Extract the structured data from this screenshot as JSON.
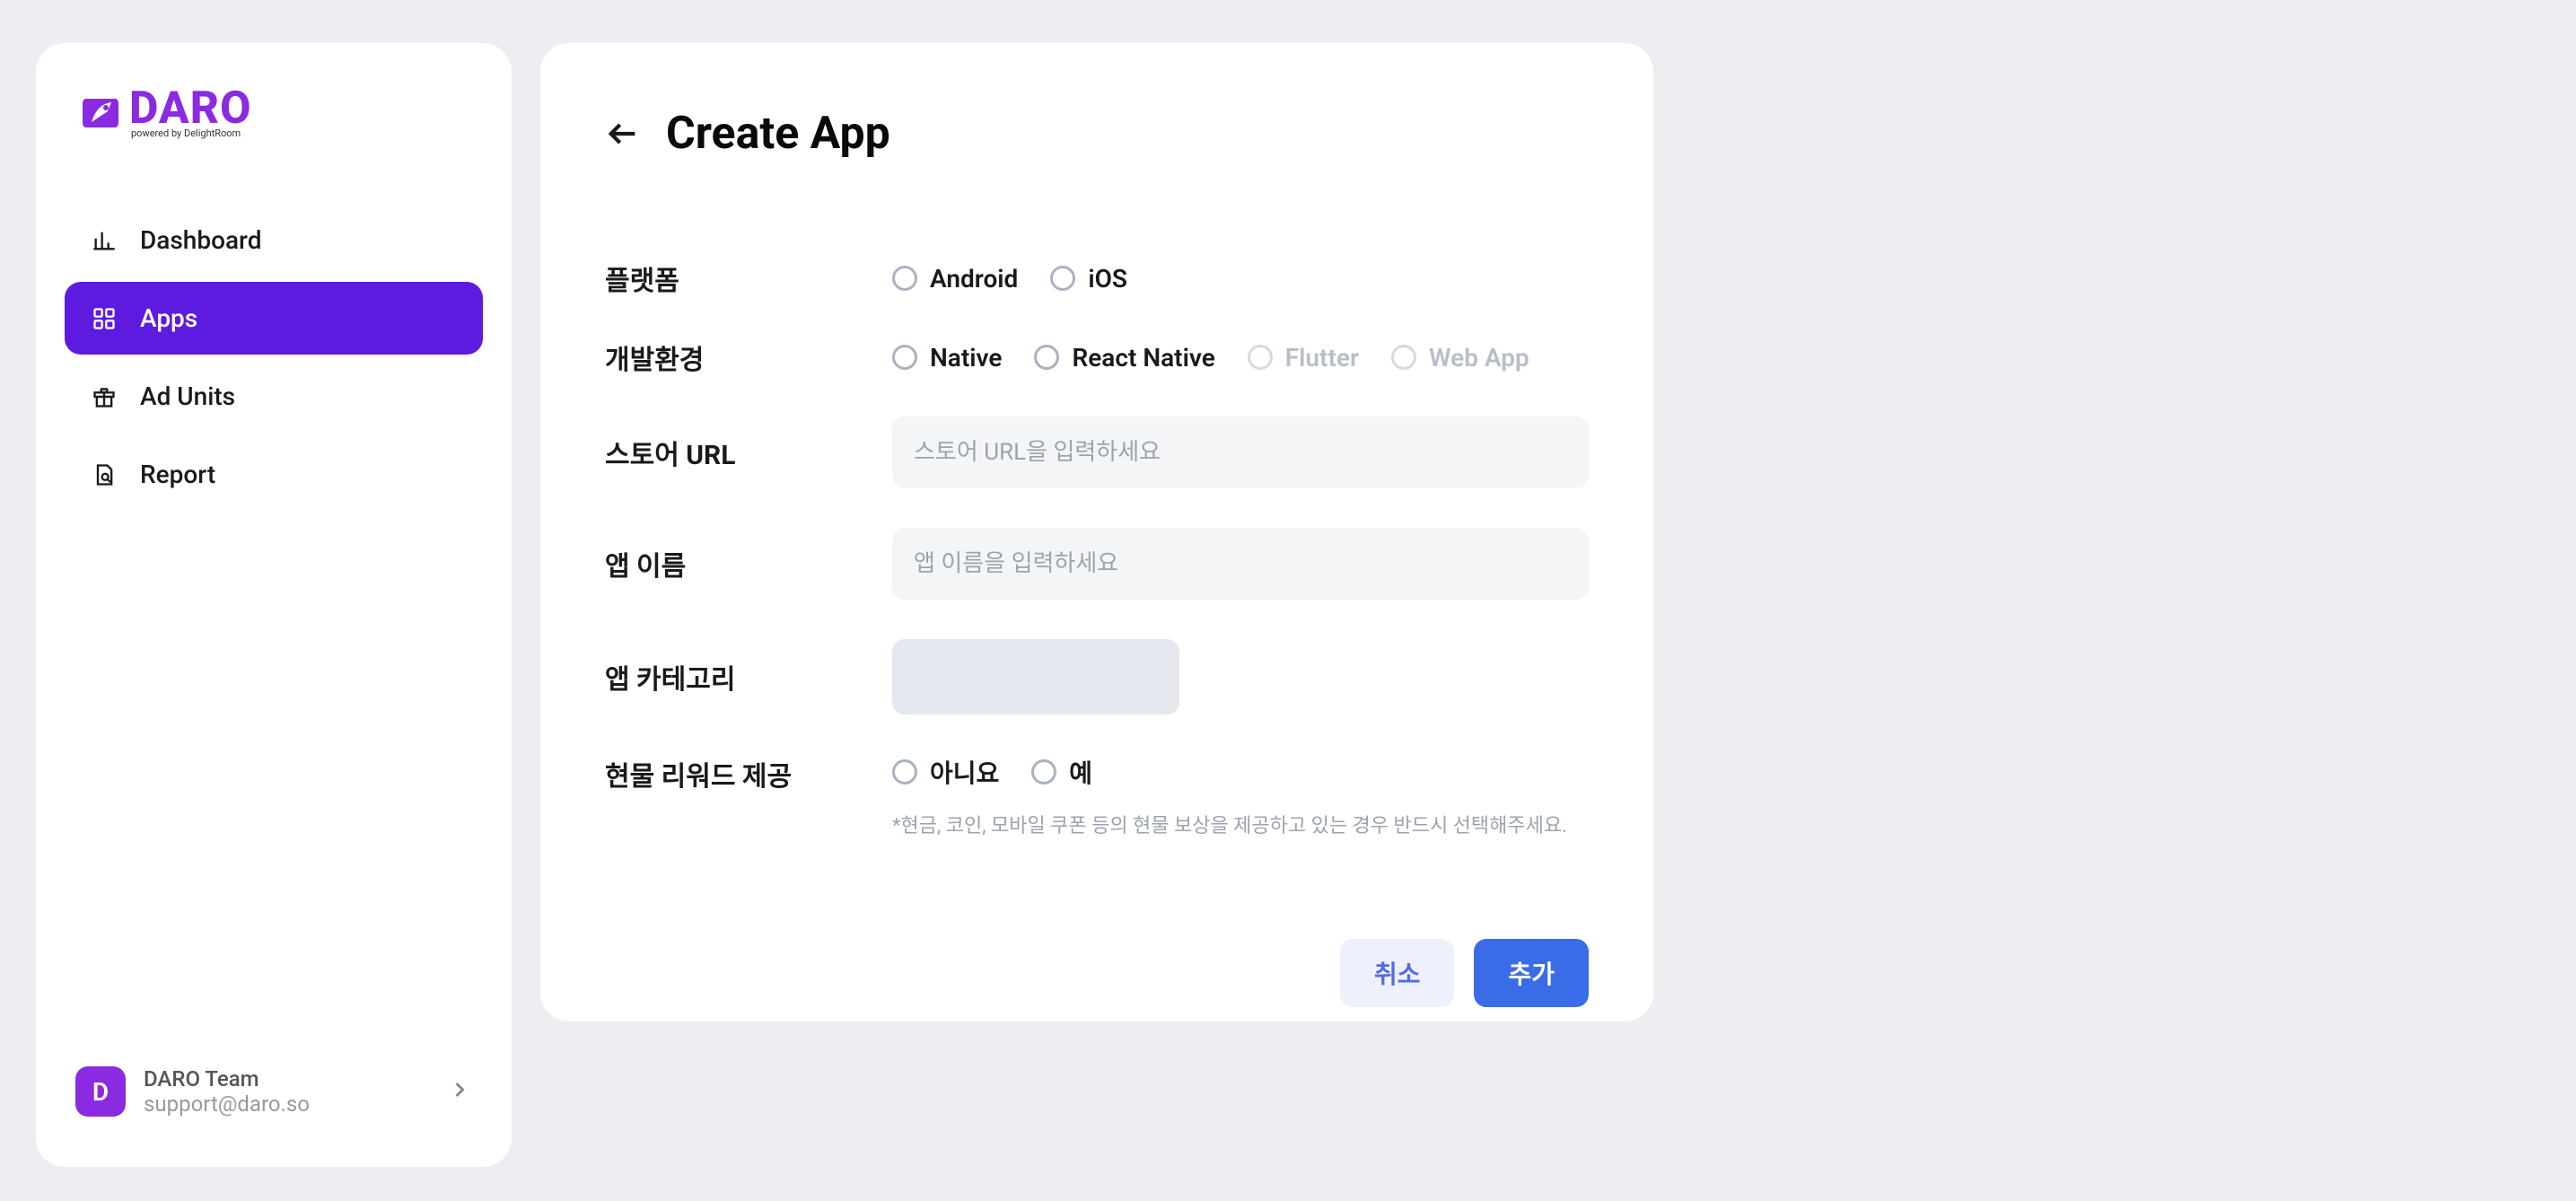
{
  "brand": {
    "name": "DARO",
    "tagline": "powered by DelightRoom"
  },
  "sidebar": {
    "items": [
      {
        "label": "Dashboard",
        "active": false,
        "icon": "chart-bar"
      },
      {
        "label": "Apps",
        "active": true,
        "icon": "grid"
      },
      {
        "label": "Ad Units",
        "active": false,
        "icon": "gift"
      },
      {
        "label": "Report",
        "active": false,
        "icon": "document-search"
      }
    ]
  },
  "user": {
    "avatar_letter": "D",
    "name": "DARO Team",
    "email": "support@daro.so"
  },
  "page": {
    "title": "Create App"
  },
  "form": {
    "platform": {
      "label": "플랫폼",
      "options": [
        {
          "label": "Android",
          "disabled": false
        },
        {
          "label": "iOS",
          "disabled": false
        }
      ]
    },
    "devenv": {
      "label": "개발환경",
      "options": [
        {
          "label": "Native",
          "disabled": false
        },
        {
          "label": "React Native",
          "disabled": false
        },
        {
          "label": "Flutter",
          "disabled": true
        },
        {
          "label": "Web App",
          "disabled": true
        }
      ]
    },
    "store_url": {
      "label": "스토어 URL",
      "placeholder": "스토어 URL을 입력하세요",
      "value": ""
    },
    "app_name": {
      "label": "앱 이름",
      "placeholder": "앱 이름을 입력하세요",
      "value": ""
    },
    "category": {
      "label": "앱 카테고리"
    },
    "reward": {
      "label": "현물 리워드 제공",
      "options": [
        {
          "label": "아니요"
        },
        {
          "label": "예"
        }
      ],
      "hint": "*현금, 코인, 모바일 쿠폰 등의 현물 보상을 제공하고 있는 경우 반드시 선택해주세요."
    }
  },
  "actions": {
    "cancel": "취소",
    "submit": "추가"
  }
}
